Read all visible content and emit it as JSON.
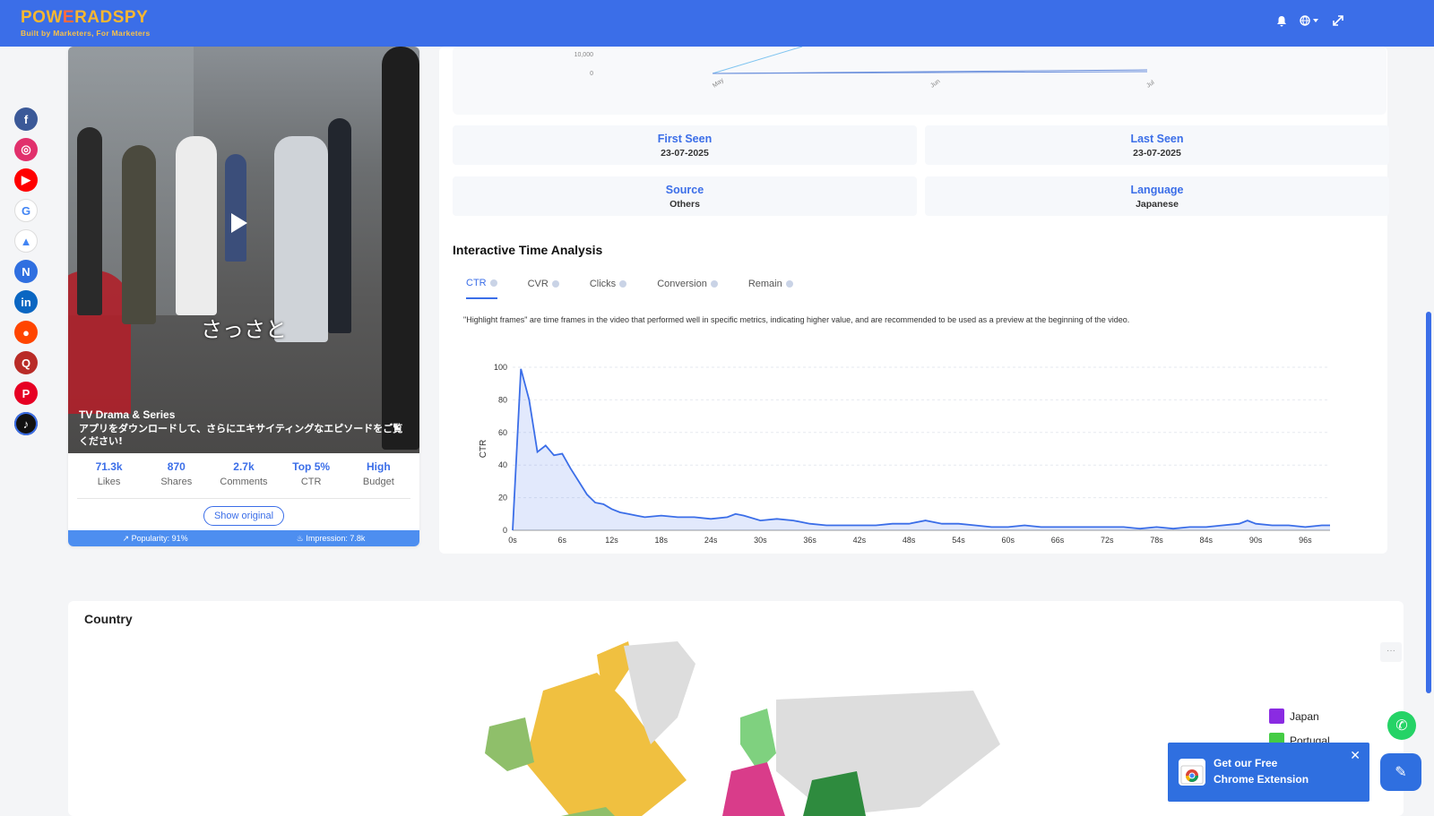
{
  "brand": {
    "name_left": "POW",
    "name_w": "E",
    "name_right": "RADSPY",
    "tagline": "Built by Marketers, For Marketers"
  },
  "socials": [
    {
      "name": "facebook-icon",
      "glyph": "f",
      "color": "#3b5998"
    },
    {
      "name": "instagram-icon",
      "glyph": "◎",
      "color": "#e1306c"
    },
    {
      "name": "youtube-icon",
      "glyph": "▶",
      "color": "#ff0000"
    },
    {
      "name": "google-icon",
      "glyph": "G",
      "color": "#ffffff"
    },
    {
      "name": "google-ads-icon",
      "glyph": "▲",
      "color": "#ffffff"
    },
    {
      "name": "native-icon",
      "glyph": "N",
      "color": "#2f6fe0"
    },
    {
      "name": "linkedin-icon",
      "glyph": "in",
      "color": "#0a66c2"
    },
    {
      "name": "reddit-icon",
      "glyph": "●",
      "color": "#ff4500"
    },
    {
      "name": "quora-icon",
      "glyph": "Q",
      "color": "#b92b27"
    },
    {
      "name": "pinterest-icon",
      "glyph": "P",
      "color": "#e60023"
    },
    {
      "name": "tiktok-icon",
      "glyph": "♪",
      "color": "#111111"
    }
  ],
  "ad": {
    "subtitle_jp": "さっさと",
    "title": "TV Drama & Series",
    "description": "アプリをダウンロードして、さらにエキサイティングなエピソードをご覧ください!",
    "stats": [
      {
        "value": "71.3k",
        "label": "Likes"
      },
      {
        "value": "870",
        "label": "Shares"
      },
      {
        "value": "2.7k",
        "label": "Comments"
      },
      {
        "value": "Top 5%",
        "label": "CTR"
      },
      {
        "value": "High",
        "label": "Budget"
      }
    ],
    "show_original": "Show original",
    "popularity": "Popularity: 91%",
    "impression": "Impression: 7.8k"
  },
  "mini_chart": {
    "y_ticks": [
      "10,000",
      "0"
    ],
    "x_ticks": [
      "May",
      "Jun",
      "Jul"
    ]
  },
  "info": {
    "first_seen_label": "First Seen",
    "first_seen": "23-07-2025",
    "last_seen_label": "Last Seen",
    "last_seen": "23-07-2025",
    "source_label": "Source",
    "source": "Others",
    "language_label": "Language",
    "language": "Japanese"
  },
  "time_analysis": {
    "title": "Interactive Time Analysis",
    "tabs": [
      "CTR",
      "CVR",
      "Clicks",
      "Conversion",
      "Remain"
    ],
    "active_tab": "CTR",
    "note": "\"Highlight frames\" are time frames in the video that performed well in specific metrics, indicating higher value, and are recommended to be used as a preview at the beginning of the video."
  },
  "chart_data": {
    "type": "area",
    "ylabel": "CTR",
    "ylim": [
      0,
      100
    ],
    "y_ticks": [
      0,
      20,
      40,
      60,
      80,
      100
    ],
    "x_ticks": [
      "0s",
      "6s",
      "12s",
      "18s",
      "24s",
      "30s",
      "36s",
      "42s",
      "48s",
      "54s",
      "60s",
      "66s",
      "72s",
      "78s",
      "84s",
      "90s",
      "96s"
    ],
    "xlim": [
      0,
      99
    ],
    "color": "#3b6ee8",
    "x": [
      0,
      1,
      2,
      3,
      4,
      5,
      6,
      7,
      8,
      9,
      10,
      11,
      12,
      13,
      14,
      15,
      16,
      18,
      20,
      22,
      24,
      26,
      27,
      28,
      30,
      32,
      34,
      36,
      38,
      40,
      42,
      44,
      46,
      48,
      50,
      52,
      54,
      56,
      58,
      60,
      62,
      64,
      66,
      68,
      70,
      72,
      74,
      76,
      78,
      80,
      82,
      84,
      86,
      88,
      89,
      90,
      92,
      94,
      96,
      98,
      99
    ],
    "values": [
      0,
      99,
      80,
      48,
      52,
      46,
      47,
      38,
      30,
      22,
      17,
      16,
      13,
      11,
      10,
      9,
      8,
      9,
      8,
      8,
      7,
      8,
      10,
      9,
      6,
      7,
      6,
      4,
      3,
      3,
      3,
      3,
      4,
      4,
      6,
      4,
      4,
      3,
      2,
      2,
      3,
      2,
      2,
      2,
      2,
      2,
      2,
      1,
      2,
      1,
      2,
      2,
      3,
      4,
      6,
      4,
      3,
      3,
      2,
      3,
      3
    ]
  },
  "country": {
    "title": "Country",
    "legend": [
      {
        "name": "Japan",
        "color": "#8a2be2"
      },
      {
        "name": "Portugal",
        "color": "#44cc44"
      }
    ]
  },
  "promo": {
    "line1": "Get our Free",
    "line2": "Chrome Extension"
  }
}
